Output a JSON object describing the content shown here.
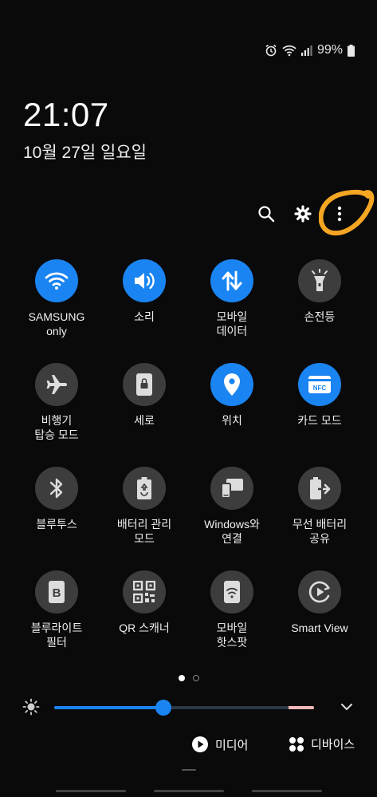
{
  "status": {
    "battery": "99%"
  },
  "clock": {
    "time": "21:07",
    "date": "10월 27일 일요일"
  },
  "tiles": [
    {
      "label": "SAMSUNG\nonly",
      "icon": "wifi-icon",
      "on": true
    },
    {
      "label": "소리",
      "icon": "sound-icon",
      "on": true
    },
    {
      "label": "모바일\n데이터",
      "icon": "mobile-data-icon",
      "on": true
    },
    {
      "label": "손전등",
      "icon": "flashlight-icon",
      "on": false
    },
    {
      "label": "비행기\n탑승 모드",
      "icon": "airplane-icon",
      "on": false
    },
    {
      "label": "세로",
      "icon": "portrait-lock-icon",
      "on": false
    },
    {
      "label": "위치",
      "icon": "location-icon",
      "on": true
    },
    {
      "label": "카드 모드",
      "icon": "nfc-icon",
      "on": true
    },
    {
      "label": "블루투스",
      "icon": "bluetooth-icon",
      "on": false
    },
    {
      "label": "배터리 관리\n모드",
      "icon": "battery-saver-icon",
      "on": false
    },
    {
      "label": "Windows와\n연결",
      "icon": "link-to-windows-icon",
      "on": false
    },
    {
      "label": "무선 배터리\n공유",
      "icon": "wireless-powershare-icon",
      "on": false
    },
    {
      "label": "블루라이트\n필터",
      "icon": "blue-light-filter-icon",
      "on": false
    },
    {
      "label": "QR 스캐너",
      "icon": "qr-scanner-icon",
      "on": false
    },
    {
      "label": "모바일\n핫스팟",
      "icon": "hotspot-icon",
      "on": false
    },
    {
      "label": "Smart View",
      "icon": "smart-view-icon",
      "on": false
    }
  ],
  "pager": {
    "pages": 2,
    "active": 1
  },
  "brightness": {
    "level": 0.42
  },
  "bottom": {
    "media_label": "미디어",
    "devices_label": "디바이스"
  },
  "colors": {
    "accent": "#1a84f2",
    "tile_off": "#3d3d3d",
    "highlight": "#f5a623"
  }
}
